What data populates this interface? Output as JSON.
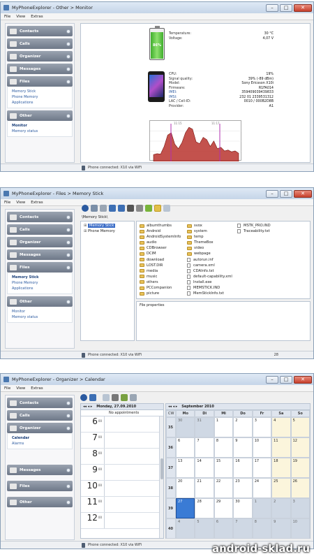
{
  "win1": {
    "title": "MyPhoneExplorer - Other > Monitor",
    "menu": [
      "File",
      "View",
      "Extras"
    ],
    "sidebar": [
      {
        "label": "Contacts"
      },
      {
        "label": "Calls"
      },
      {
        "label": "Organizer"
      },
      {
        "label": "Messages"
      },
      {
        "label": "Files"
      }
    ],
    "files_sub": [
      "Memory Stick",
      "Phone Memory",
      "Applications"
    ],
    "other_label": "Other",
    "other_sub": [
      "Monitor",
      "Memory status"
    ],
    "battery_level": "86%",
    "battery_rows": [
      {
        "k": "Temperature:",
        "v": "30 °C"
      },
      {
        "k": "Voltage:",
        "v": "4,07 V"
      }
    ],
    "phone_rows": [
      {
        "k": "CPU:",
        "v": "19%"
      },
      {
        "k": "Signal quality:",
        "v": "39% (-89 dBm)"
      },
      {
        "k": "Model:",
        "v": "Sony Ericsson X10i"
      },
      {
        "k": "Firmware:",
        "v": "R1FA014"
      },
      {
        "k": "IMEI:",
        "v": "359409039439833"
      },
      {
        "k": "IMSI:",
        "v": "232 01 2339531312"
      },
      {
        "k": "LAC / Cell-ID:",
        "v": "0010 / 000B2D8B"
      },
      {
        "k": "Provider:",
        "v": "A1"
      }
    ],
    "graph_labels": [
      "11:15",
      "11:17"
    ],
    "graph_values": [
      12,
      14,
      13,
      30,
      55,
      60,
      35,
      25,
      38,
      60,
      72,
      68,
      40,
      36,
      50,
      45,
      30,
      42,
      25,
      28,
      20,
      22,
      18,
      20,
      15
    ],
    "status": "Phone connected: X10 via WiFi"
  },
  "win2": {
    "title": "MyPhoneExplorer - Files > Memory Stick",
    "menu": [
      "File",
      "View",
      "Extras"
    ],
    "sidebar": [
      {
        "label": "Contacts"
      },
      {
        "label": "Calls"
      },
      {
        "label": "Organizer"
      },
      {
        "label": "Messages"
      },
      {
        "label": "Files"
      }
    ],
    "files_sub": [
      "Memory Stick",
      "Phone Memory",
      "Applications"
    ],
    "other_label": "Other",
    "other_sub": [
      "Monitor",
      "Memory status"
    ],
    "path": "\\Memory Stick\\",
    "tree": [
      "Memory Stick",
      "Phone Memory"
    ],
    "col1": [
      "albumthumbs",
      "Android",
      "AndroidSystemInfo",
      "audio",
      "CDBrowser",
      "DCIM",
      "download",
      "LOST.DIR",
      "media",
      "music",
      "others",
      "PCCompanion",
      "picture"
    ],
    "col2": [
      {
        "n": "svox",
        "t": "folder"
      },
      {
        "n": "system",
        "t": "folder"
      },
      {
        "n": "temp",
        "t": "folder"
      },
      {
        "n": "ThemeBox",
        "t": "folder"
      },
      {
        "n": "video",
        "t": "folder"
      },
      {
        "n": "webpage",
        "t": "folder"
      },
      {
        "n": "autorun.inf",
        "t": "file"
      },
      {
        "n": "camera.xml",
        "t": "file"
      },
      {
        "n": "CDAInfo.txt",
        "t": "file"
      },
      {
        "n": "default-capability.xml",
        "t": "file"
      },
      {
        "n": "Install.exe",
        "t": "file"
      },
      {
        "n": "MEMSTICK.IND",
        "t": "file"
      },
      {
        "n": "MemStickInfo.txt",
        "t": "file"
      }
    ],
    "col3": [
      "MSTK_PRO.IND",
      "Traceability.txt"
    ],
    "file_properties": "File properties",
    "count": "28",
    "status": "Phone connected: X10 via WiFi"
  },
  "win3": {
    "title": "MyPhoneExplorer - Organizer > Calendar",
    "menu": [
      "File",
      "View",
      "Extras"
    ],
    "organizer_sub": [
      "Calendar",
      "Alarms"
    ],
    "sidebar_top": [
      {
        "label": "Contacts"
      },
      {
        "label": "Calls"
      },
      {
        "label": "Organizer"
      }
    ],
    "sidebar_bottom": [
      {
        "label": "Messages"
      },
      {
        "label": "Files"
      },
      {
        "label": "Other"
      }
    ],
    "day_title": "Monday, 27.09.2010",
    "no_appointments": "No appointments",
    "hours": [
      "6",
      "7",
      "8",
      "9",
      "10",
      "11",
      "12"
    ],
    "minutes": "00",
    "month_title": "September 2010",
    "weekdays": [
      "Mo",
      "Di",
      "Mi",
      "Do",
      "Fr",
      "Sa",
      "So"
    ],
    "cw_label": "CW",
    "weeks": [
      {
        "cw": "35",
        "days": [
          "30",
          "31",
          "1",
          "2",
          "3",
          "4",
          "5"
        ]
      },
      {
        "cw": "36",
        "days": [
          "6",
          "7",
          "8",
          "9",
          "10",
          "11",
          "12"
        ]
      },
      {
        "cw": "37",
        "days": [
          "13",
          "14",
          "15",
          "16",
          "17",
          "18",
          "19"
        ]
      },
      {
        "cw": "38",
        "days": [
          "20",
          "21",
          "22",
          "23",
          "24",
          "25",
          "26"
        ]
      },
      {
        "cw": "39",
        "days": [
          "27",
          "28",
          "29",
          "30",
          "1",
          "2",
          "3"
        ]
      },
      {
        "cw": "40",
        "days": [
          "4",
          "5",
          "6",
          "7",
          "8",
          "9",
          "10"
        ]
      }
    ],
    "status": "Phone connected: X10 via WiFi"
  },
  "watermark": "android-sklad.ru"
}
